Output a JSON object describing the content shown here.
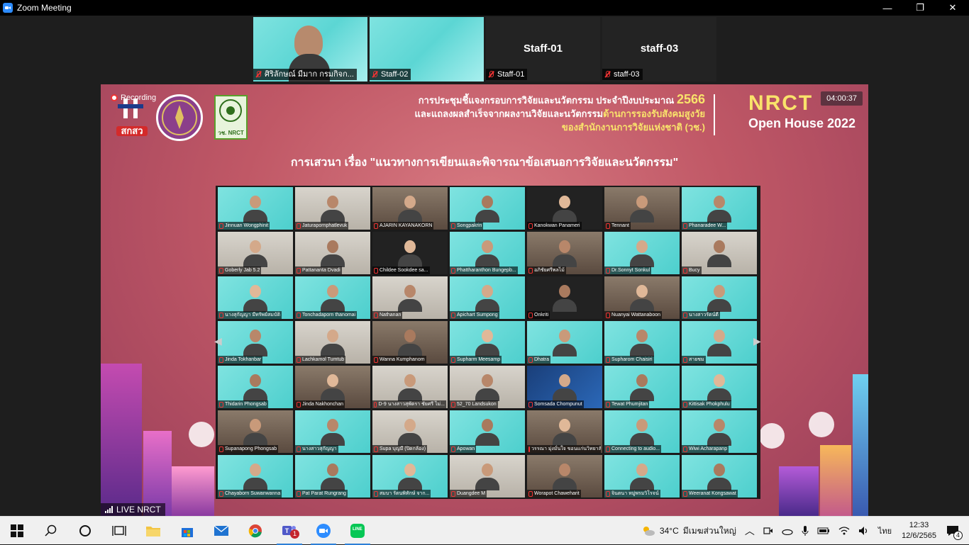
{
  "window": {
    "title": "Zoom Meeting",
    "controls": {
      "minimize": "—",
      "restore": "❐",
      "close": "✕"
    }
  },
  "thumbnails": [
    {
      "caption": "ศิริลักษณ์ มีมาก กรมกิจก..."
    },
    {
      "caption": "Staff-02"
    },
    {
      "big_name": "Staff-01",
      "caption": "Staff-01"
    },
    {
      "big_name": "staff-03",
      "caption": "staff-03"
    }
  ],
  "share": {
    "recording_label": "Recording",
    "timer": "04:00:37",
    "logo1_text": "สกสว",
    "logo3_text": "วช. NRCT",
    "header_line1": "การประชุมชี้แจงกรอบการวิจัยและนวัตกรรม ประจำปีงบประมาณ",
    "header_year": "2566",
    "header_line2_a": "และแถลงผลสำเร็จจากผลงานวิจัยและนวัตกรรม",
    "header_line2_b": "ด้านการรองรับสังคมสูงวัย",
    "header_line3": "ของสำนักงานการวิจัยแห่งชาติ (วช.)",
    "nrct": "NRCT",
    "open_house": "Open House 2022",
    "topic": "การเสวนา เรื่อง \"แนวทางการเขียนและพิจารณาข้อเสนอการวิจัยและนวัตกรรม\"",
    "live_label": "LIVE NRCT"
  },
  "gallery": [
    "Jinnuan Wongphinit",
    "Jaturapornphatlevuk",
    "AJARIN KAYANAKORN",
    "Songpakrin",
    "Kanokwan Panameri",
    "Tennant",
    "Phanaradee W...",
    "Goberly Jab 5.2",
    "Pattananta Dvadi",
    "Childee Sookdee sa...",
    "Phattharanthon Bungepb...",
    "อภิชัยศรีพลไม้",
    "Dr.Sonnyt Sonkul",
    "Bucy",
    "นางสุกัญญา มีทรัพย์สมบัติ",
    "Tonchadaporn thanomai",
    "Nathanan",
    "Apichart Sumpong",
    "Onkriti",
    "Nuanyai Wattanaboon",
    "นางสาวรัตน์ดี",
    "Jinda Tokhanbar",
    "Lachkamol Tumtub",
    "Wanna Kumphanom",
    "Supharm Meesamp",
    "Dhatra",
    "Supharom Chaisiri",
    "สายชม",
    "Thidarin Phongsab",
    "Jinda Nakhonchan",
    "D-9 นางสาวสุพัตรา ชัยศรี ไม่...",
    "52_70 Landsukon",
    "Somsada Chompunut",
    "Tewat Phumjitan",
    "Kittisak Phokphulu",
    "Supanapong Phongsab",
    "นางสาวสุกัญญา",
    "Supa บุญมี (ปิดกล้อง)",
    "Apowan",
    "วรรณา มุ่งมั่นใจ ขอนแก่นวิทยาลัย",
    "Connecting to audio...",
    "Wiwi Acharapanp",
    "Chayaborn Suwanwanna",
    "Pat Parat Rungrang",
    "สมบา รัตนพิทักษ์ จาก...",
    "Duangdee M",
    "Worapot Chaweharit",
    "จินตนา หมู่พรมวิโรจน์",
    "Weeranat Kongsawat"
  ],
  "taskbar": {
    "weather_temp": "34°C",
    "weather_text": "มีเมฆส่วนใหญ่",
    "lang": "ไทย",
    "time": "12:33",
    "date": "12/6/2565",
    "notif_count": "4",
    "teams_badge": "1",
    "line_label": "LINE"
  }
}
